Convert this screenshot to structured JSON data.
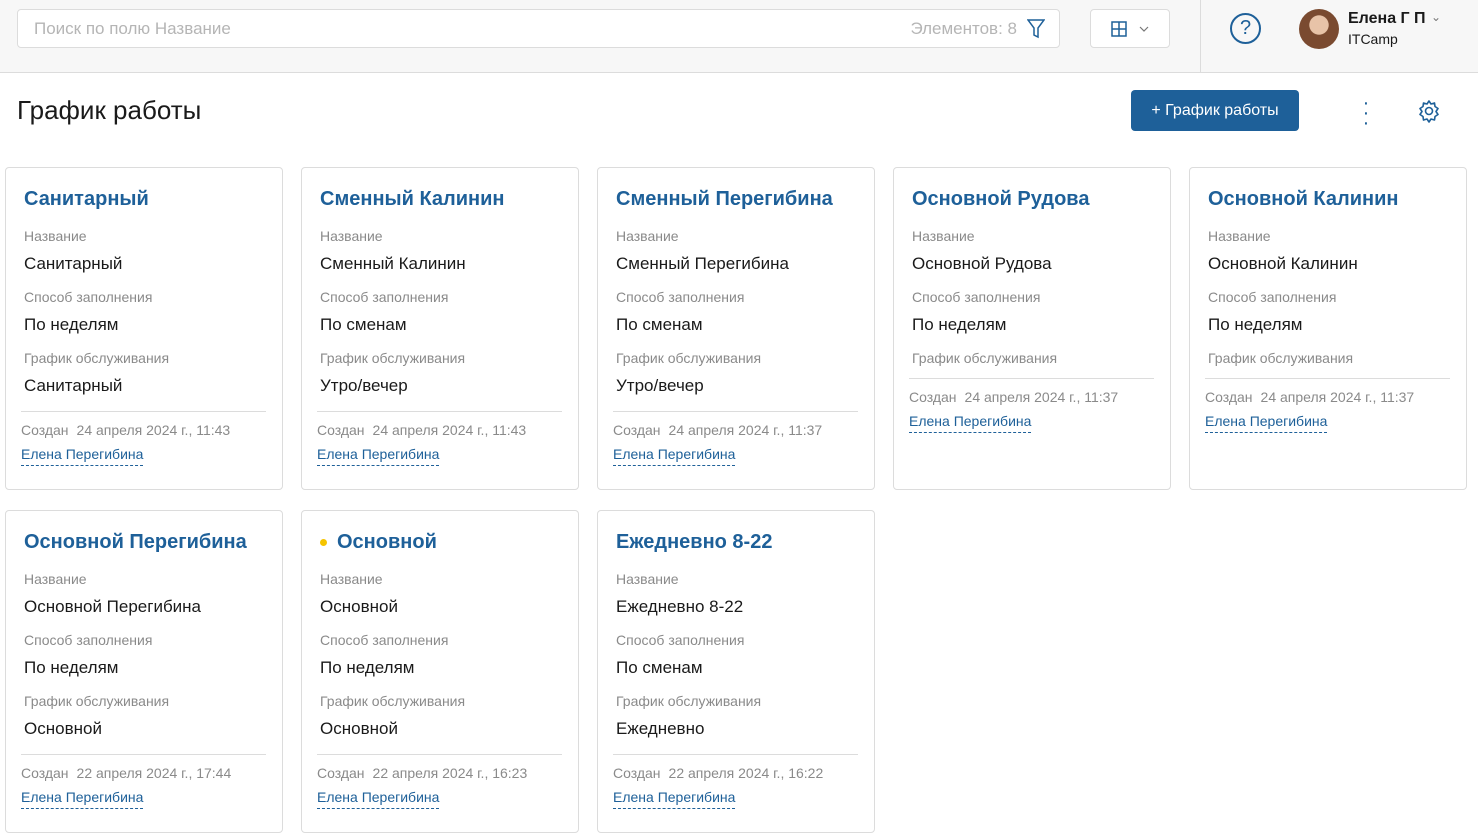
{
  "search": {
    "placeholder": "Поиск по полю Название",
    "count": "Элементов: 8"
  },
  "user": {
    "name": "Елена Г П",
    "org": "ITCamp"
  },
  "page": {
    "title": "График работы",
    "add_label": "+ График работы"
  },
  "labels": {
    "name": "Название",
    "fill": "Способ заполнения",
    "service": "График обслуживания",
    "created": "Создан"
  },
  "cards": [
    {
      "title": "Санитарный",
      "name": "Санитарный",
      "fill": "По неделям",
      "service": "Санитарный",
      "date": "24 апреля 2024 г., 11:43",
      "author": "Елена Перегибина"
    },
    {
      "title": "Сменный Калинин",
      "name": "Сменный Калинин",
      "fill": "По сменам",
      "service": "Утро/вечер",
      "date": "24 апреля 2024 г., 11:43",
      "author": "Елена Перегибина"
    },
    {
      "title": "Сменный Перегибина",
      "name": "Сменный Перегибина",
      "fill": "По сменам",
      "service": "Утро/вечер",
      "date": "24 апреля 2024 г., 11:37",
      "author": "Елена Перегибина"
    },
    {
      "title": "Основной Рудова",
      "name": "Основной Рудова",
      "fill": "По неделям",
      "service": "",
      "date": "24 апреля 2024 г., 11:37",
      "author": "Елена Перегибина"
    },
    {
      "title": "Основной Калинин",
      "name": "Основной Калинин",
      "fill": "По неделям",
      "service": "",
      "date": "24 апреля 2024 г., 11:37",
      "author": "Елена Перегибина"
    },
    {
      "title": "Основной Перегибина",
      "name": "Основной Перегибина",
      "fill": "По неделям",
      "service": "Основной",
      "date": "22 апреля 2024 г., 17:44",
      "author": "Елена Перегибина"
    },
    {
      "title": "Основной",
      "name": "Основной",
      "fill": "По неделям",
      "service": "Основной",
      "date": "22 апреля 2024 г., 16:23",
      "author": "Елена Перегибина",
      "marker": true
    },
    {
      "title": "Ежедневно 8-22",
      "name": "Ежедневно 8-22",
      "fill": "По сменам",
      "service": "Ежедневно",
      "date": "22 апреля 2024 г., 16:22",
      "author": "Елена Перегибина"
    }
  ]
}
